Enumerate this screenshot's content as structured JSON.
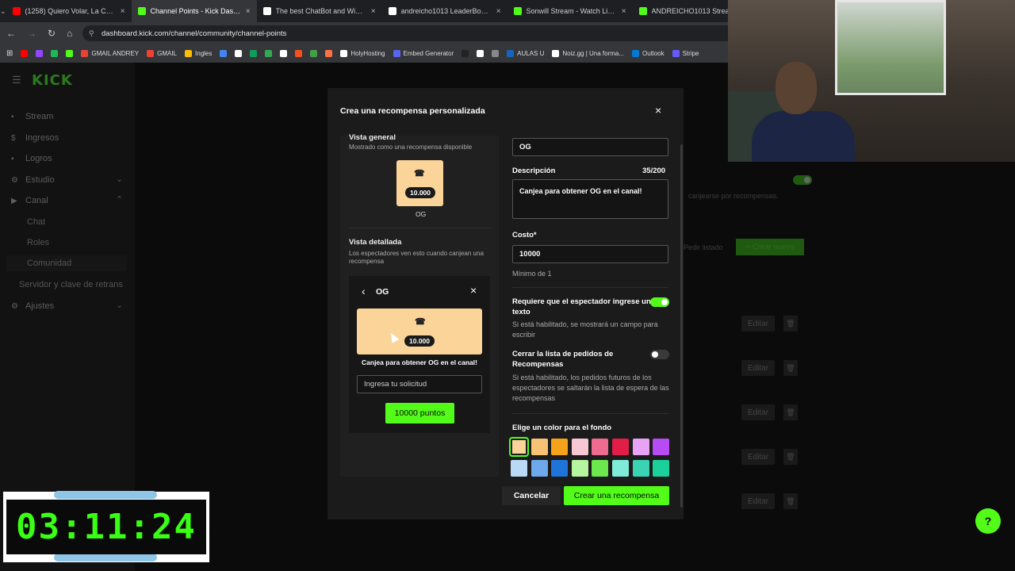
{
  "tabs": [
    {
      "title": "(1258) Quiero Volar, La Com",
      "color": "#ff0000",
      "close": "×",
      "active": false
    },
    {
      "title": "Channel Points - Kick Dashboa",
      "color": "#53fc18",
      "close": "×",
      "active": true
    },
    {
      "title": "The best ChatBot and Widgets",
      "color": "#ffffff",
      "close": "×",
      "active": false
    },
    {
      "title": "andreicho1013 LeaderBoard | T",
      "color": "#ffffff",
      "close": "×",
      "active": false
    },
    {
      "title": "Sonwill Stream - Watch Live on",
      "color": "#53fc18",
      "close": "×",
      "active": false
    },
    {
      "title": "ANDREICHO1013 Strea",
      "color": "#53fc18",
      "close": "×",
      "active": false
    }
  ],
  "address": {
    "url": "dashboard.kick.com/channel/community/channel-points"
  },
  "bookmarks": [
    {
      "label": "",
      "color": "#ff0000"
    },
    {
      "label": "",
      "color": "#9146ff"
    },
    {
      "label": "",
      "color": "#1db954"
    },
    {
      "label": "",
      "color": "#53fc18"
    },
    {
      "label": "GMAIL ANDREY",
      "color": "#ea4335"
    },
    {
      "label": "GMAIL",
      "color": "#ea4335"
    },
    {
      "label": "Ingles",
      "color": "#fbbc04"
    },
    {
      "label": "",
      "color": "#4285f4"
    },
    {
      "label": "",
      "color": "#ffffff"
    },
    {
      "label": "",
      "color": "#0f9d58"
    },
    {
      "label": "",
      "color": "#34a853"
    },
    {
      "label": "",
      "color": "#ffffff"
    },
    {
      "label": "",
      "color": "#f4511e"
    },
    {
      "label": "",
      "color": "#43a047"
    },
    {
      "label": "",
      "color": "#ff7043"
    },
    {
      "label": "HolyHosting",
      "color": "#ffffff"
    },
    {
      "label": "Embed Generator",
      "color": "#5865f2"
    },
    {
      "label": "",
      "color": "#222222"
    },
    {
      "label": "",
      "color": "#ffffff"
    },
    {
      "label": "",
      "color": "#888888"
    },
    {
      "label": "AULAS U",
      "color": "#1565c0"
    },
    {
      "label": "Noiz.gg | Una forma...",
      "color": "#ffffff"
    },
    {
      "label": "Outlook",
      "color": "#0078d4"
    },
    {
      "label": "Stripe",
      "color": "#635bff"
    }
  ],
  "sidebar": {
    "logo": "KICK",
    "items": [
      {
        "label": "Stream",
        "icon": "•",
        "sub": false
      },
      {
        "label": "Ingresos",
        "icon": "$",
        "sub": false
      },
      {
        "label": "Logros",
        "icon": "▪",
        "sub": false
      },
      {
        "label": "Estudio",
        "icon": "⚙",
        "sub": false,
        "chev": "⌄"
      },
      {
        "label": "Canal",
        "icon": "▶",
        "sub": false,
        "chev": "⌃"
      },
      {
        "label": "Chat",
        "icon": "",
        "sub": true
      },
      {
        "label": "Roles",
        "icon": "",
        "sub": true
      },
      {
        "label": "Comunidad",
        "icon": "",
        "sub": true,
        "selected": true
      },
      {
        "label": "Servidor y clave de retrans",
        "icon": "",
        "sub": true
      },
      {
        "label": "Ajustes",
        "icon": "⚙",
        "sub": false,
        "chev": "⌄"
      }
    ]
  },
  "background": {
    "subtitle": "canjearse por recompensas.",
    "order_list": "Pedir listado",
    "create_new": "+ Crear nuevo",
    "edit_label": "Editar",
    "trash": "🗑"
  },
  "modal": {
    "title": "Crea una recompensa personalizada",
    "close": "×",
    "overview": {
      "heading": "Vista general",
      "sub": "Mostrado como una recompensa disponible",
      "points": "10.000",
      "name": "OG"
    },
    "detail": {
      "heading": "Vista detallada",
      "sub": "Los espectadores ven esto cuando canjean una recompensa",
      "back": "‹",
      "name": "OG",
      "close": "×",
      "points": "10.000",
      "desc": "Canjea para obtener OG en el canal!",
      "input_placeholder": "Ingresa tu solicitud",
      "button": "10000 puntos"
    },
    "form": {
      "title_value": "OG",
      "desc_label": "Descripción",
      "desc_count": "35/200",
      "desc_value": "Canjea para obtener OG en el canal!",
      "cost_label": "Costo*",
      "cost_value": "10000",
      "cost_min": "Mínimo de 1",
      "require_label": "Requiere que el espectador ingrese un texto",
      "require_note": "Si está habilitado, se mostrará un campo para escribir",
      "require_on": true,
      "close_label": "Cerrar la lista de pedidos de Recompensas",
      "close_note": "Si está habilitado, los pedidos futuros de los espectadores se saltarán la lista de espera de las recompensas",
      "close_on": false,
      "color_label": "Elige un color para el fondo",
      "colors_row1": [
        "#fbd49a",
        "#f8c274",
        "#f7a21b",
        "#f7c7d3",
        "#ef6b8f",
        "#e11d48",
        "#e9a3f5",
        "#b84cf4"
      ],
      "colors_row2": [
        "#b9d9f7",
        "#6ea9ec",
        "#1f74d9",
        "#b6f5a0",
        "#6ce84e",
        "#7eecd9",
        "#3ad4b5",
        "#1bd09a"
      ],
      "selected_color": "#fbd49a",
      "cancel": "Cancelar",
      "submit": "Crear una recompensa"
    }
  },
  "timer": {
    "value": "03:11:24"
  },
  "accent": "#53fc18"
}
